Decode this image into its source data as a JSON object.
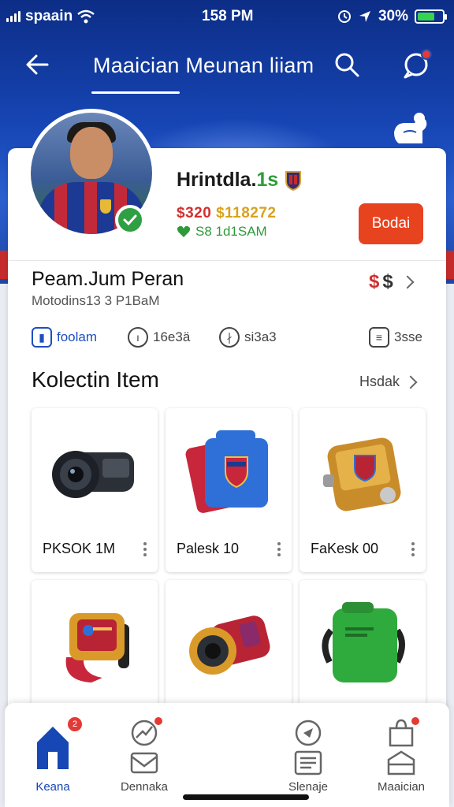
{
  "status_bar": {
    "carrier": "spaain",
    "time": "158 PM",
    "battery": "30%",
    "battery_level": 0.7,
    "icons": [
      "signal-icon",
      "wifi-icon",
      "alarm-icon",
      "location-icon",
      "battery-icon"
    ]
  },
  "header": {
    "title": "Maaician Meunan liiam",
    "icons": [
      "back-arrow-icon",
      "search-icon",
      "chat-icon"
    ]
  },
  "profile": {
    "name_prefix": "Hrintdla.",
    "name_suffix": "1s",
    "price_main": "$320",
    "price_secondary": "$118272",
    "price_sub": "S8 1d1SAM",
    "bid_label": "Bodai"
  },
  "section": {
    "name": "Peam.Jum Peran",
    "subtitle": "Motodins13 3 P1BaM",
    "currency_a": "$",
    "currency_b": "$"
  },
  "stats": [
    {
      "icon": "shield-icon",
      "label": "foolam"
    },
    {
      "icon": "clock-icon",
      "label": "16e3ä"
    },
    {
      "icon": "person-icon",
      "label": "si3a3"
    },
    {
      "icon": "chat-box-icon",
      "label": "3sse"
    }
  ],
  "collection": {
    "title": "Kolectin Item",
    "more_label": "Hsdak",
    "items": [
      {
        "label": "PKSOK 1M",
        "icon": "camera-lens-icon"
      },
      {
        "label": "Palesk 10",
        "icon": "card-pack-icon"
      },
      {
        "label": "FaKesk 00",
        "icon": "gold-case-icon"
      },
      {
        "label": "",
        "icon": "watch-icon"
      },
      {
        "label": "",
        "icon": "lens-gadget-icon"
      },
      {
        "label": "",
        "icon": "green-pack-icon"
      }
    ]
  },
  "bottom_nav": [
    {
      "label": "Keana",
      "icon": "home-icon",
      "badge": "2",
      "active": true
    },
    {
      "label": "Dennaka",
      "icon": "inbox-icon",
      "badge": "",
      "active": false
    },
    {
      "label": "Slenaje",
      "icon": "list-icon",
      "badge": "",
      "active": false
    },
    {
      "label": "Maaician",
      "icon": "shop-icon",
      "badge": "",
      "active": false
    }
  ],
  "colors": {
    "brand_blue": "#1746b5",
    "accent_red": "#e8431f",
    "price_red": "#d32f2f",
    "price_green": "#2e9a3a"
  }
}
